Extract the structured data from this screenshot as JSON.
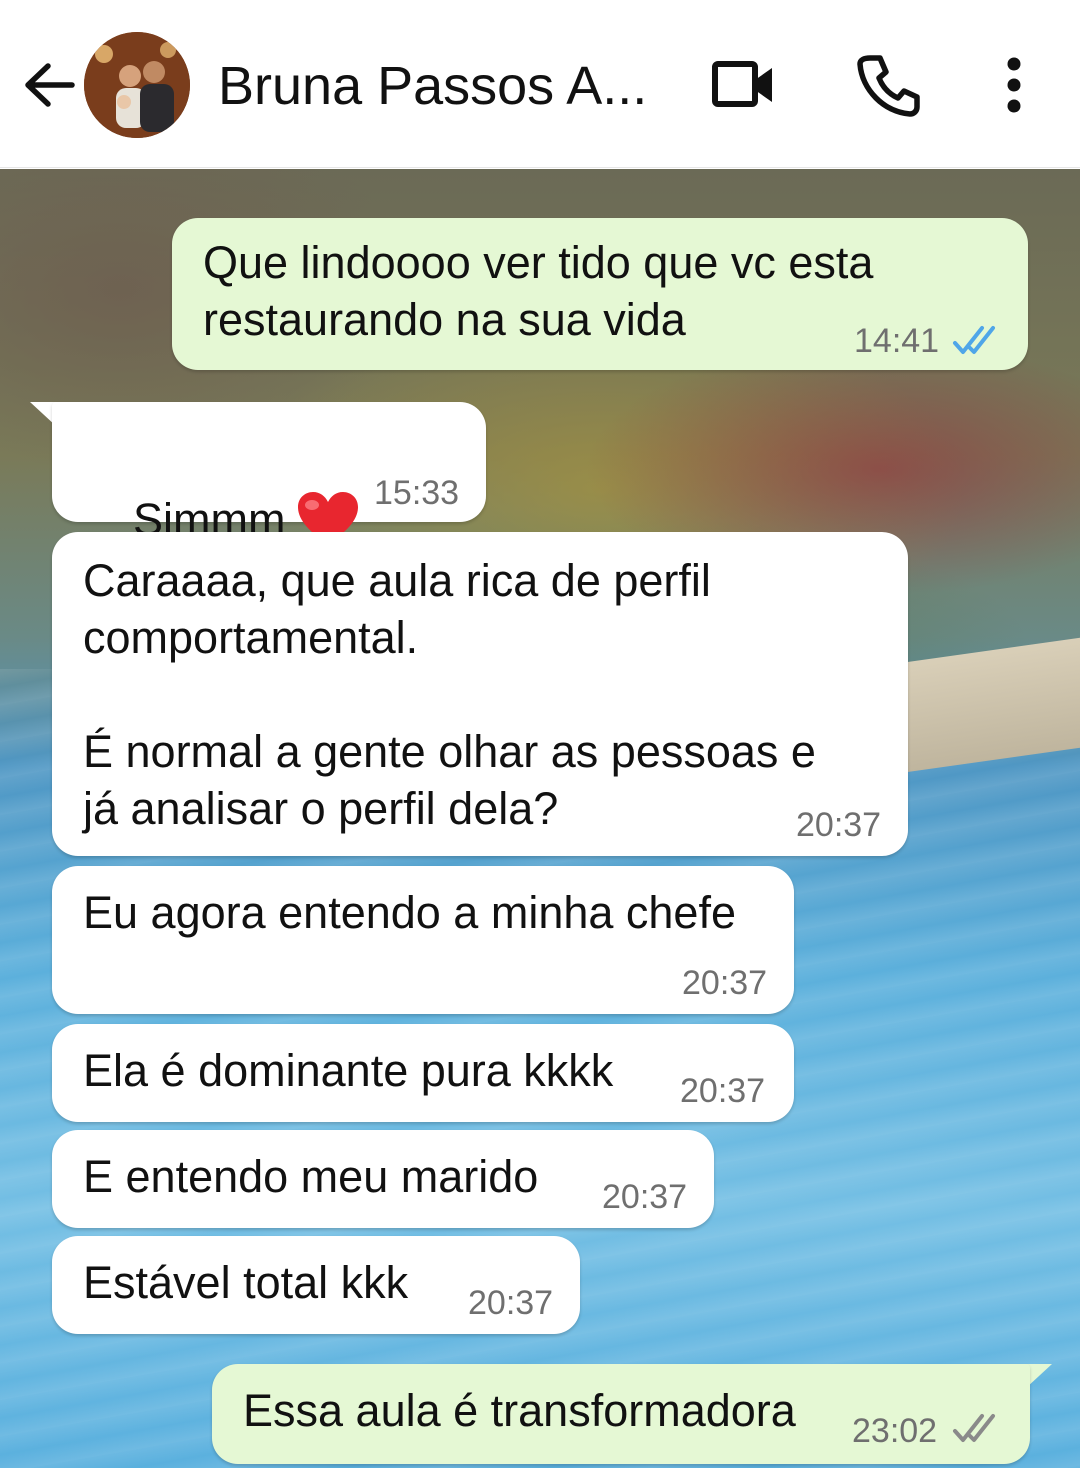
{
  "header": {
    "contact_name": "Bruna Passos A...",
    "back_icon": "arrow-left-icon",
    "video_icon": "video-camera-icon",
    "call_icon": "phone-icon",
    "menu_icon": "more-vertical-icon"
  },
  "colors": {
    "incoming_bubble": "#ffffff",
    "outgoing_bubble": "#e5f8d4",
    "read_ticks": "#4fa6e8",
    "delivered_ticks": "#8a8a8a"
  },
  "messages": [
    {
      "direction": "outgoing",
      "text": "Que lindoooo ver tido que vc esta\nrestaurando na sua vida",
      "time": "14:41",
      "status": "read"
    },
    {
      "direction": "incoming",
      "text": "Simmm",
      "emoji": "red-heart-icon",
      "time": "15:33"
    },
    {
      "direction": "incoming",
      "text": "Caraaaa, que aula rica de perfil\ncomportamental.\n\nÉ normal a gente olhar as pessoas e\njá analisar o perfil dela?",
      "time": "20:37"
    },
    {
      "direction": "incoming",
      "text": "Eu agora entendo a minha chefe",
      "time": "20:37"
    },
    {
      "direction": "incoming",
      "text": "Ela é dominante pura kkkk",
      "time": "20:37"
    },
    {
      "direction": "incoming",
      "text": "E entendo meu marido",
      "time": "20:37"
    },
    {
      "direction": "incoming",
      "text": "Estável total kkk",
      "time": "20:37"
    },
    {
      "direction": "outgoing",
      "text": "Essa aula é transformadora",
      "time": "23:02",
      "status": "delivered"
    }
  ]
}
